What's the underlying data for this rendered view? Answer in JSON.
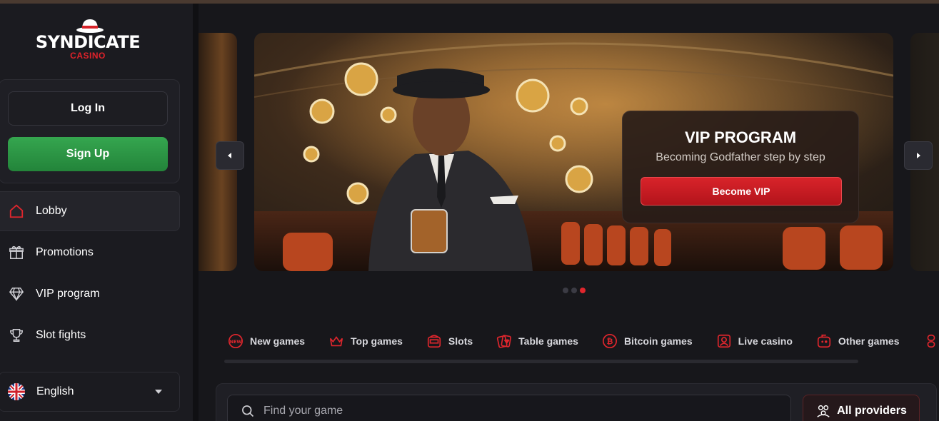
{
  "brand": {
    "name": "SYNDICATE",
    "tagline": "CASINO",
    "accent": "#e0222a"
  },
  "auth": {
    "login_label": "Log In",
    "signup_label": "Sign Up"
  },
  "sidebar": {
    "items": [
      {
        "label": "Lobby",
        "icon": "home-icon",
        "active": true
      },
      {
        "label": "Promotions",
        "icon": "gift-icon"
      },
      {
        "label": "VIP program",
        "icon": "diamond-icon"
      },
      {
        "label": "Slot fights",
        "icon": "trophy-icon"
      }
    ],
    "language": {
      "label": "English",
      "icon": "uk-flag-icon"
    }
  },
  "banner": {
    "title": "VIP PROGRAM",
    "subtitle": "Becoming Godfather step by step",
    "cta": "Become VIP",
    "slide_count": 3,
    "active_slide": 3
  },
  "categories": [
    {
      "label": "New games",
      "icon": "new-badge-icon"
    },
    {
      "label": "Top games",
      "icon": "crown-icon"
    },
    {
      "label": "Slots",
      "icon": "slot-machine-icon"
    },
    {
      "label": "Table games",
      "icon": "cards-icon"
    },
    {
      "label": "Bitcoin games",
      "icon": "bitcoin-icon"
    },
    {
      "label": "Live casino",
      "icon": "live-dealer-icon"
    },
    {
      "label": "Other games",
      "icon": "gamepad-icon"
    }
  ],
  "search": {
    "placeholder": "Find your game",
    "providers_label": "All providers"
  }
}
